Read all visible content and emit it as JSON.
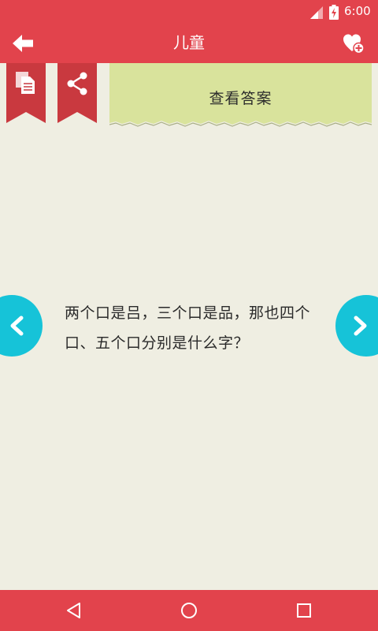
{
  "status_bar": {
    "time": "6:00",
    "icons": [
      "signal-icon",
      "battery-icon"
    ]
  },
  "header": {
    "title": "儿童",
    "left_icon": "back-arrow-icon",
    "right_icon": "favorite-heart-icon"
  },
  "actions": {
    "copy_icon": "copy-document-icon",
    "share_icon": "share-icon",
    "answer_button_label": "查看答案"
  },
  "content": {
    "riddle_text": "两个口是吕，三个口是品，那也四个口、五个口分别是什么字？"
  },
  "navigation": {
    "prev_icon": "chevron-left-icon",
    "next_icon": "chevron-right-icon"
  },
  "system_nav": {
    "icons": [
      "triangle-back-icon",
      "circle-home-icon",
      "square-recents-icon"
    ]
  },
  "colors": {
    "primary": "#e2434c",
    "ribbon": "#c9393f",
    "background": "#efeee2",
    "card": "#d9e39c",
    "accent": "#16c3d8",
    "text": "#2a2a2a"
  }
}
